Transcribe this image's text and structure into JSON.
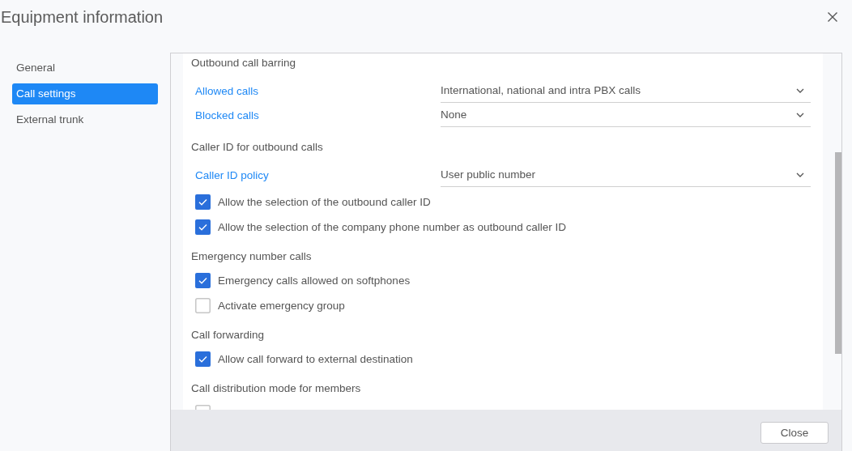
{
  "window": {
    "title": "Equipment information"
  },
  "sidebar": {
    "items": [
      {
        "label": "General",
        "selected": false
      },
      {
        "label": "Call settings",
        "selected": true
      },
      {
        "label": "External trunk",
        "selected": false
      }
    ]
  },
  "sections": [
    {
      "title": "Outbound call barring",
      "items": [
        {
          "kind": "select",
          "label": "Allowed calls",
          "value": "International, national and intra PBX calls"
        },
        {
          "kind": "select",
          "label": "Blocked calls",
          "value": "None"
        }
      ]
    },
    {
      "title": "Caller ID for outbound calls",
      "items": [
        {
          "kind": "select",
          "label": "Caller ID policy",
          "value": "User public number"
        },
        {
          "kind": "checkbox",
          "label": "Allow the selection of the outbound caller ID",
          "checked": true
        },
        {
          "kind": "checkbox",
          "label": "Allow the selection of the company phone number as outbound caller ID",
          "checked": true
        }
      ]
    },
    {
      "title": "Emergency number calls",
      "items": [
        {
          "kind": "checkbox",
          "label": "Emergency calls allowed on softphones",
          "checked": true
        },
        {
          "kind": "checkbox",
          "label": "Activate emergency group",
          "checked": false
        }
      ]
    },
    {
      "title": "Call forwarding",
      "items": [
        {
          "kind": "checkbox",
          "label": "Allow call forward to external destination",
          "checked": true
        }
      ]
    },
    {
      "title": "Call distribution mode for members",
      "items": [
        {
          "kind": "checkbox",
          "checked": false
        }
      ]
    }
  ],
  "footer": {
    "buttons": [
      "Close"
    ]
  }
}
